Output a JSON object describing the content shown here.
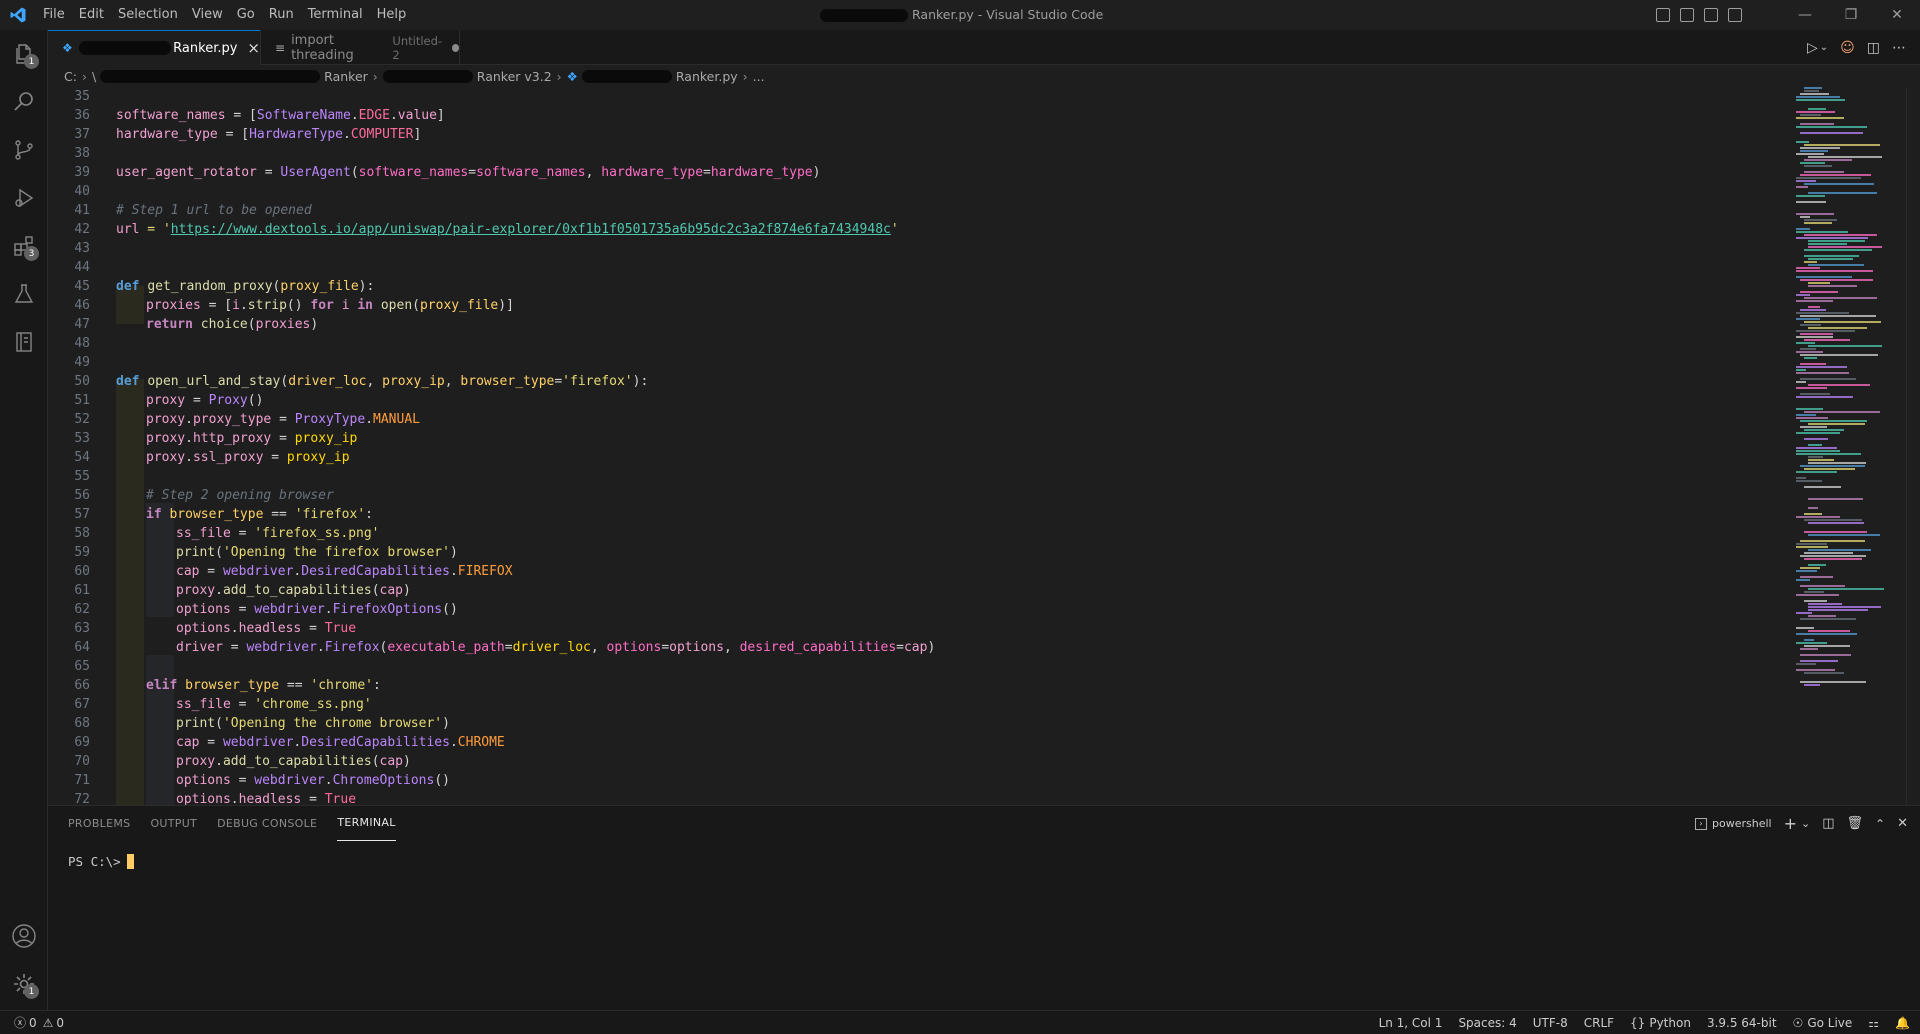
{
  "window": {
    "title_suffix": "Ranker.py - Visual Studio Code"
  },
  "menu": [
    "File",
    "Edit",
    "Selection",
    "View",
    "Go",
    "Run",
    "Terminal",
    "Help"
  ],
  "activity_badges": {
    "explorer": "1",
    "extensions": "3",
    "settings": "1"
  },
  "tabs": [
    {
      "label": "Ranker.py",
      "close": "×"
    },
    {
      "label": "import threading",
      "sublabel": "Untitled-2"
    }
  ],
  "breadcrumb": {
    "root": "C:",
    "root_short": "\\",
    "seg1": "Ranker",
    "seg2": "Ranker v3.2",
    "file": "Ranker.py",
    "more": "..."
  },
  "code_lines": [
    {
      "n": "35"
    },
    {
      "n": "36"
    },
    {
      "n": "37"
    },
    {
      "n": "38"
    },
    {
      "n": "39"
    },
    {
      "n": "40"
    },
    {
      "n": "41"
    },
    {
      "n": "42"
    },
    {
      "n": "43"
    },
    {
      "n": "44"
    },
    {
      "n": "45"
    },
    {
      "n": "46"
    },
    {
      "n": "47"
    },
    {
      "n": "48"
    },
    {
      "n": "49"
    },
    {
      "n": "50"
    },
    {
      "n": "51"
    },
    {
      "n": "52"
    },
    {
      "n": "53"
    },
    {
      "n": "54"
    },
    {
      "n": "55"
    },
    {
      "n": "56"
    },
    {
      "n": "57"
    },
    {
      "n": "58"
    },
    {
      "n": "59"
    },
    {
      "n": "60"
    },
    {
      "n": "61"
    },
    {
      "n": "62"
    },
    {
      "n": "63"
    },
    {
      "n": "64"
    },
    {
      "n": "65"
    },
    {
      "n": "66"
    },
    {
      "n": "67"
    },
    {
      "n": "68"
    },
    {
      "n": "69"
    },
    {
      "n": "70"
    },
    {
      "n": "71"
    },
    {
      "n": "72"
    }
  ],
  "code": {
    "l36": [
      "software_names",
      " = [",
      "SoftwareName",
      ".",
      "EDGE",
      ".",
      "value",
      "]"
    ],
    "l37": [
      "hardware_type",
      " = [",
      "HardwareType",
      ".",
      "COMPUTER",
      "]"
    ],
    "l39": [
      "user_agent_rotator",
      " = ",
      "UserAgent",
      "(",
      "software_names",
      "=",
      "software_names",
      ", ",
      "hardware_type",
      "=",
      "hardware_type",
      ")"
    ],
    "l41": "# Step 1 url to be opened",
    "l42": [
      "url",
      " = '",
      "https://www.dextools.io/app/uniswap/pair-explorer/0xf1b1f0501735a6b95dc2c3a2f874e6fa7434948c",
      "'"
    ],
    "l45": [
      "def",
      " ",
      "get_random_proxy",
      "(",
      "proxy_file",
      "):"
    ],
    "l46": [
      "proxies",
      " = [",
      "i",
      ".",
      "strip",
      "() ",
      "for",
      " ",
      "i",
      " ",
      "in",
      " ",
      "open",
      "(",
      "proxy_file",
      ")]"
    ],
    "l47": [
      "return",
      " ",
      "choice",
      "(",
      "proxies",
      ")"
    ],
    "l50": [
      "def",
      " ",
      "open_url_and_stay",
      "(",
      "driver_loc",
      ", ",
      "proxy_ip",
      ", ",
      "browser_type",
      "=",
      "'firefox'",
      "):"
    ],
    "l51": [
      "proxy",
      " = ",
      "Proxy",
      "()"
    ],
    "l52": [
      "proxy",
      ".",
      "proxy_type",
      " = ",
      "ProxyType",
      ".",
      "MANUAL"
    ],
    "l53": [
      "proxy",
      ".",
      "http_proxy",
      " = ",
      "proxy_ip"
    ],
    "l54": [
      "proxy",
      ".",
      "ssl_proxy",
      " = ",
      "proxy_ip"
    ],
    "l56": "# Step 2 opening browser",
    "l57": [
      "if",
      " ",
      "browser_type",
      " == ",
      "'firefox'",
      ":"
    ],
    "l58": [
      "ss_file",
      " = ",
      "'firefox_ss.png'"
    ],
    "l59": [
      "print",
      "(",
      "'Opening the firefox browser'",
      ")"
    ],
    "l60": [
      "cap",
      " = ",
      "webdriver",
      ".",
      "DesiredCapabilities",
      ".",
      "FIREFOX"
    ],
    "l61": [
      "proxy",
      ".",
      "add_to_capabilities",
      "(",
      "cap",
      ")"
    ],
    "l62": [
      "options",
      " = ",
      "webdriver",
      ".",
      "FirefoxOptions",
      "()"
    ],
    "l63": [
      "options",
      ".",
      "headless",
      " = ",
      "True"
    ],
    "l64": [
      "driver",
      " = ",
      "webdriver",
      ".",
      "Firefox",
      "(",
      "executable_path",
      "=",
      "driver_loc",
      ", ",
      "options",
      "=",
      "options",
      ", ",
      "desired_capabilities",
      "=",
      "cap",
      ")"
    ],
    "l66": [
      "elif",
      " ",
      "browser_type",
      " == ",
      "'chrome'",
      ":"
    ],
    "l67": [
      "ss_file",
      " = ",
      "'chrome_ss.png'"
    ],
    "l68": [
      "print",
      "(",
      "'Opening the chrome browser'",
      ")"
    ],
    "l69": [
      "cap",
      " = ",
      "webdriver",
      ".",
      "DesiredCapabilities",
      ".",
      "CHROME"
    ],
    "l70": [
      "proxy",
      ".",
      "add_to_capabilities",
      "(",
      "cap",
      ")"
    ],
    "l71": [
      "options",
      " = ",
      "webdriver",
      ".",
      "ChromeOptions",
      "()"
    ],
    "l72": [
      "options",
      ".",
      "headless",
      " = ",
      "True"
    ]
  },
  "panel": {
    "tabs": [
      "PROBLEMS",
      "OUTPUT",
      "DEBUG CONSOLE",
      "TERMINAL"
    ],
    "shell": "powershell",
    "prompt": "PS C:\\>"
  },
  "status": {
    "errors": "0",
    "warnings": "0",
    "position": "Ln 1, Col 1",
    "spaces": "Spaces: 4",
    "encoding": "UTF-8",
    "eol": "CRLF",
    "language": "Python",
    "interpreter": "3.9.5 64-bit",
    "golive": "Go Live"
  },
  "colors": {
    "accent": "#0078d4",
    "cursor": "#ffcc66",
    "vscode_blue": "#3ea6ff"
  }
}
